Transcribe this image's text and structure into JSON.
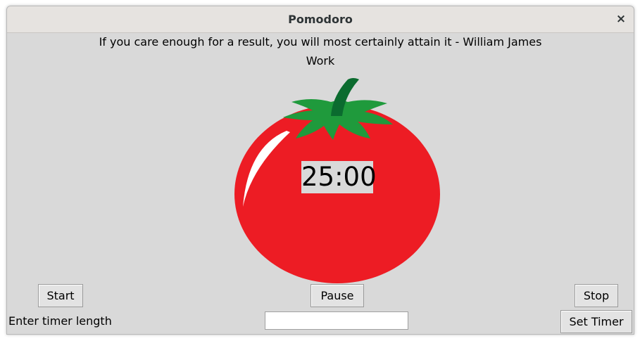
{
  "window": {
    "title": "Pomodoro",
    "close_glyph": "×"
  },
  "quote": "If you care enough for a result, you will most certainly attain it - William James",
  "mode_label": "Work",
  "timer": {
    "display": "25:00"
  },
  "buttons": {
    "start": "Start",
    "pause": "Pause",
    "stop": "Stop",
    "set_timer": "Set Timer"
  },
  "timer_length": {
    "label": "Enter timer length",
    "value": "",
    "placeholder": ""
  },
  "colors": {
    "tomato": "#ed1c24",
    "leaves": "#1f9a3c",
    "stem": "#0b6b2f",
    "background": "#d9d9d9"
  },
  "icons": {
    "close": "close-icon",
    "tomato": "tomato-image"
  }
}
